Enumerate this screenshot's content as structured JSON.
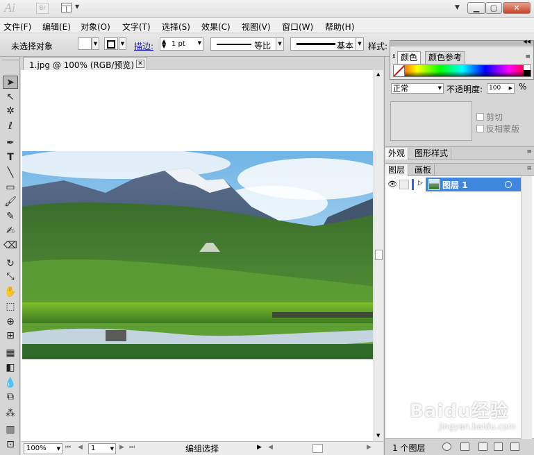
{
  "titlebar": {
    "logo": "Ai",
    "bridge_badge": "Br"
  },
  "menu": [
    {
      "label": "文件(F)"
    },
    {
      "label": "编辑(E)"
    },
    {
      "label": "对象(O)"
    },
    {
      "label": "文字(T)"
    },
    {
      "label": "选择(S)"
    },
    {
      "label": "效果(C)"
    },
    {
      "label": "视图(V)"
    },
    {
      "label": "窗口(W)"
    },
    {
      "label": "帮助(H)"
    }
  ],
  "control": {
    "selection_status": "未选择对象",
    "stroke_label": "描边:",
    "stroke_weight": "1 pt",
    "profile_label": "等比",
    "brush_label": "基本",
    "style_label": "样式:"
  },
  "document": {
    "tab_title": "1.jpg @ 100% (RGB/预览)"
  },
  "status": {
    "zoom": "100%",
    "page": "1",
    "tool_text": "编组选择"
  },
  "color_panel": {
    "tabs": [
      "颜色",
      "颜色参考"
    ]
  },
  "transparency": {
    "blend_mode": "正常",
    "opacity_label": "不透明度:",
    "opacity_value": "100",
    "opacity_unit": "%",
    "clip_label": "剪切",
    "invert_label": "反相蒙版"
  },
  "appearance_panel": {
    "tabs": [
      "外观",
      "图形样式"
    ]
  },
  "layers_panel": {
    "tabs": [
      "图层",
      "画板"
    ],
    "layers": [
      {
        "name": "图层 1"
      }
    ],
    "count_label": "1 个图层"
  },
  "watermark": {
    "brand": "Baidu经验",
    "url": "jingyan.baidu.com"
  }
}
